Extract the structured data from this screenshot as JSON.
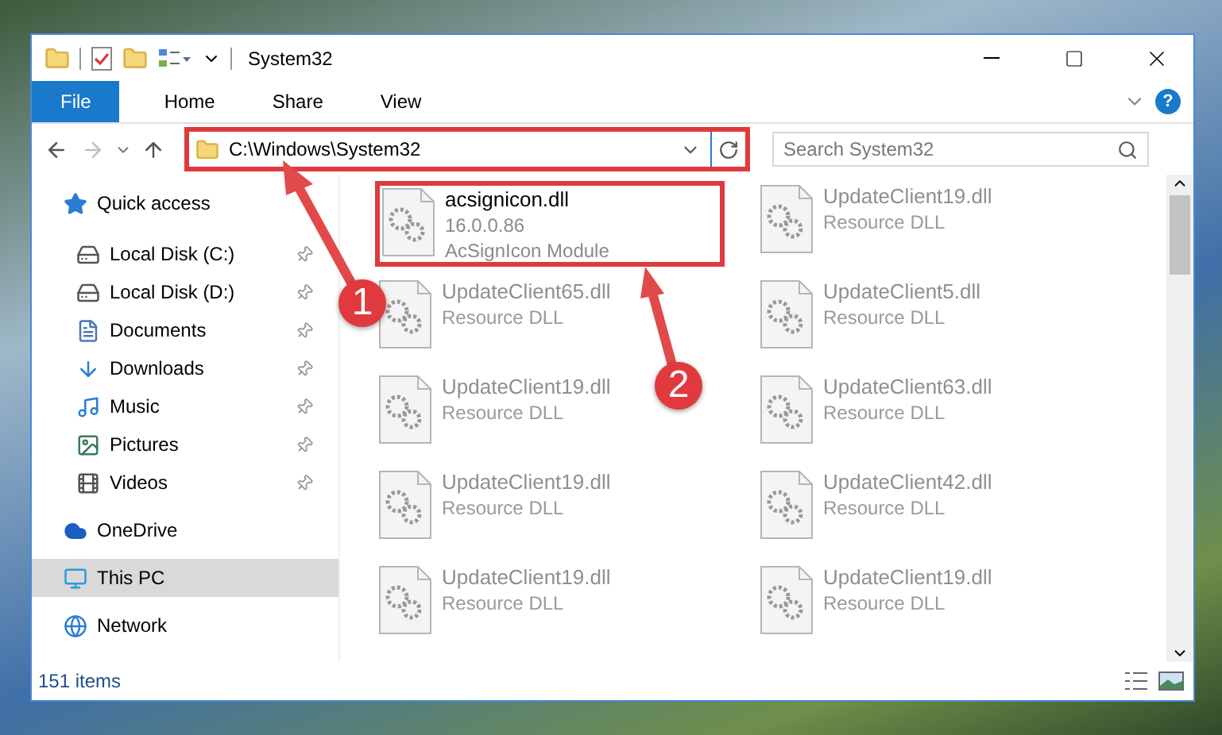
{
  "window": {
    "title": "System32"
  },
  "ribbon": {
    "tabs": [
      {
        "label": "File",
        "kind": "file",
        "selected": false
      },
      {
        "label": "Home",
        "kind": "tab",
        "selected": false
      },
      {
        "label": "Share",
        "kind": "tab",
        "selected": false
      },
      {
        "label": "View",
        "kind": "tab",
        "selected": false
      }
    ],
    "help": "?"
  },
  "navigation": {
    "back_disabled": false,
    "forward_disabled": true
  },
  "address": {
    "value": "C:\\Windows\\System32",
    "highlighted": true
  },
  "search": {
    "placeholder": "Search System32"
  },
  "sidebar": {
    "items": [
      {
        "label": "Quick access",
        "kind": "star",
        "selected": false,
        "pinned": false,
        "children": [
          {
            "label": "Local Disk (C:)",
            "kind": "disk-c",
            "selected": false,
            "pinned": true
          },
          {
            "label": "Local Disk (D:)",
            "kind": "disk",
            "selected": false,
            "pinned": true
          },
          {
            "label": "Documents",
            "kind": "documents",
            "selected": false,
            "pinned": true
          },
          {
            "label": "Downloads",
            "kind": "downloads",
            "selected": false,
            "pinned": true
          },
          {
            "label": "Music",
            "kind": "music",
            "selected": false,
            "pinned": true
          },
          {
            "label": "Pictures",
            "kind": "pictures",
            "selected": false,
            "pinned": true
          },
          {
            "label": "Videos",
            "kind": "videos",
            "selected": false,
            "pinned": true
          }
        ]
      },
      {
        "label": "OneDrive",
        "kind": "cloud",
        "selected": false,
        "pinned": false
      },
      {
        "label": "This PC",
        "kind": "pc",
        "selected": true,
        "pinned": false
      },
      {
        "label": "Network",
        "kind": "network",
        "selected": false,
        "pinned": false
      }
    ]
  },
  "files": [
    {
      "name": "acsignicon.dll",
      "lines": [
        "16.0.0.86",
        "AcSignIcon Module"
      ],
      "faded": false,
      "highlighted": true
    },
    {
      "name": "UpdateClient19.dll",
      "lines": [
        "Resource DLL"
      ],
      "faded": true,
      "highlighted": false
    },
    {
      "name": "UpdateClient65.dll",
      "lines": [
        "Resource DLL"
      ],
      "faded": true,
      "highlighted": false
    },
    {
      "name": "UpdateClient5.dll",
      "lines": [
        "Resource DLL"
      ],
      "faded": true,
      "highlighted": false
    },
    {
      "name": "UpdateClient19.dll",
      "lines": [
        "Resource DLL"
      ],
      "faded": true,
      "highlighted": false
    },
    {
      "name": "UpdateClient63.dll",
      "lines": [
        "Resource DLL"
      ],
      "faded": true,
      "highlighted": false
    },
    {
      "name": "UpdateClient19.dll",
      "lines": [
        "Resource DLL"
      ],
      "faded": true,
      "highlighted": false
    },
    {
      "name": "UpdateClient42.dll",
      "lines": [
        "Resource DLL"
      ],
      "faded": true,
      "highlighted": false
    },
    {
      "name": "UpdateClient19.dll",
      "lines": [
        "Resource DLL"
      ],
      "faded": true,
      "highlighted": false
    },
    {
      "name": "UpdateClient19.dll",
      "lines": [
        "Resource DLL"
      ],
      "faded": true,
      "highlighted": false
    }
  ],
  "status_bar": {
    "items": "151 items"
  },
  "callouts": [
    {
      "number": "1"
    },
    {
      "number": "2"
    }
  ]
}
